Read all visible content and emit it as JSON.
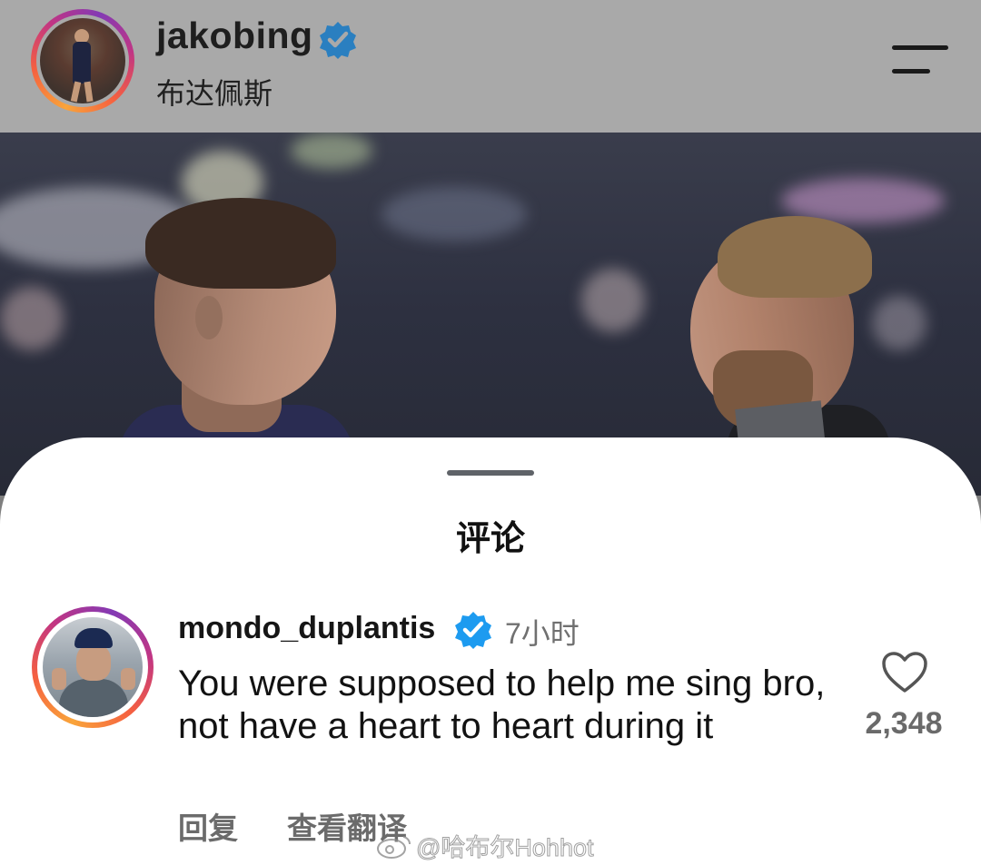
{
  "post": {
    "username": "jakobing",
    "location": "布达佩斯"
  },
  "comments_sheet": {
    "title": "评论",
    "comment": {
      "username": "mondo_duplantis",
      "time": "7小时",
      "text": "You were supposed to help me sing bro, not have a heart to heart during it",
      "like_count": "2,348",
      "reply_label": "回复",
      "translate_label": "查看翻译"
    }
  },
  "watermark": {
    "text": "@哈布尔Hohhot"
  },
  "icons": {
    "verified": "verified-badge-icon",
    "menu": "hamburger-menu-icon",
    "like": "heart-outline-icon",
    "watermark_logo": "weibo-logo-icon"
  },
  "colors": {
    "verified_blue": "#1d9bf0",
    "header_overlay": "#a9a9a9",
    "secondary_text": "#6b6b6b"
  }
}
